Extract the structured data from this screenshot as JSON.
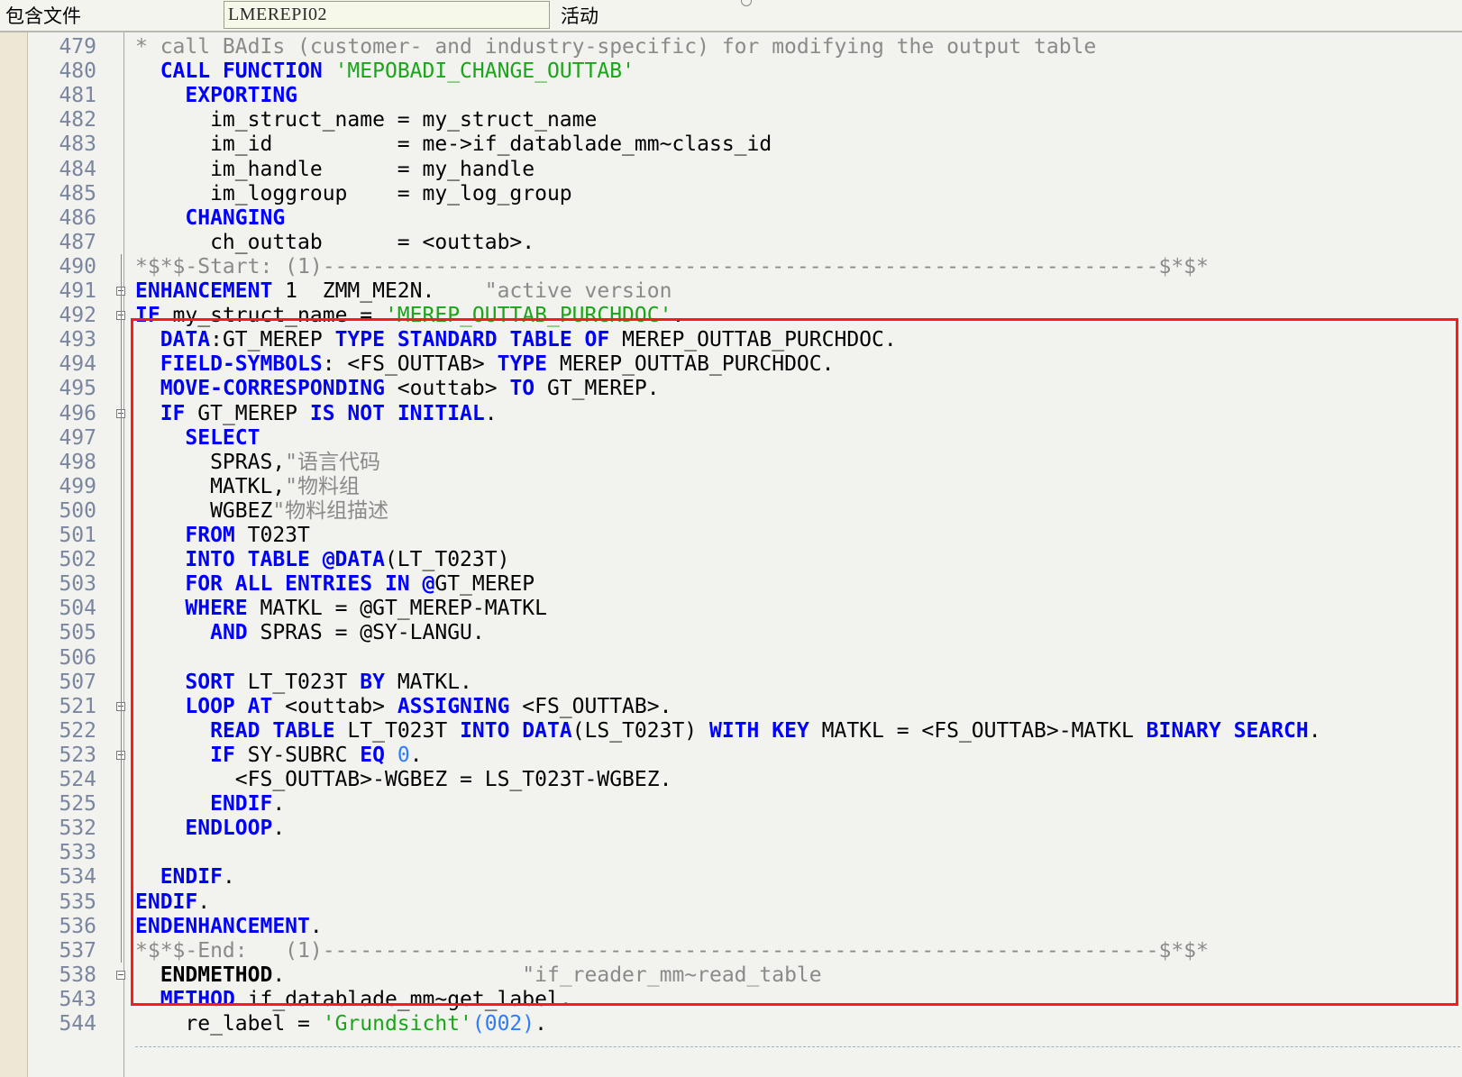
{
  "topbar": {
    "include_label": "包含文件",
    "program_name": "LMEREPI02",
    "status": "活动"
  },
  "colors": {
    "keyword": "#0000ff",
    "string": "#1aa51a",
    "comment": "#8a8a8a",
    "number": "#2b7cff",
    "highlight_box": "#ff1a1a",
    "line_number": "#7a86a0"
  },
  "editor": {
    "lines": [
      {
        "num": "479",
        "tokens": [
          [
            "c",
            "* call BAdIs (customer- and industry-specific) for modifying the output table"
          ]
        ]
      },
      {
        "num": "480",
        "tokens": [
          [
            "t",
            "  "
          ],
          [
            "k",
            "CALL FUNCTION"
          ],
          [
            "t",
            " "
          ],
          [
            "s",
            "'MEPOBADI_CHANGE_OUTTAB'"
          ]
        ]
      },
      {
        "num": "481",
        "tokens": [
          [
            "t",
            "    "
          ],
          [
            "k",
            "EXPORTING"
          ]
        ]
      },
      {
        "num": "482",
        "tokens": [
          [
            "t",
            "      im_struct_name = my_struct_name"
          ]
        ]
      },
      {
        "num": "483",
        "tokens": [
          [
            "t",
            "      im_id          = me->if_datablade_mm~class_id"
          ]
        ]
      },
      {
        "num": "484",
        "tokens": [
          [
            "t",
            "      im_handle      = my_handle"
          ]
        ]
      },
      {
        "num": "485",
        "tokens": [
          [
            "t",
            "      im_loggroup    = my_log_group"
          ]
        ]
      },
      {
        "num": "486",
        "tokens": [
          [
            "t",
            "    "
          ],
          [
            "k",
            "CHANGING"
          ]
        ]
      },
      {
        "num": "487",
        "tokens": [
          [
            "t",
            "      ch_outtab      = <outtab>."
          ]
        ]
      },
      {
        "num": "490",
        "tokens": [
          [
            "c",
            "*$*$-Start: (1)-------------------------------------------------------------------$*$*"
          ]
        ]
      },
      {
        "num": "491",
        "tokens": [
          [
            "k",
            "ENHANCEMENT"
          ],
          [
            "t",
            " 1  ZMM_ME2N.    "
          ],
          [
            "c",
            "\"active version"
          ]
        ]
      },
      {
        "num": "492",
        "tokens": [
          [
            "k",
            "IF"
          ],
          [
            "t",
            " my_struct_name = "
          ],
          [
            "s",
            "'MEREP_OUTTAB_PURCHDOC'"
          ],
          [
            "t",
            "."
          ]
        ]
      },
      {
        "num": "493",
        "tokens": [
          [
            "t",
            "  "
          ],
          [
            "k",
            "DATA"
          ],
          [
            "t",
            ":GT_MEREP "
          ],
          [
            "k",
            "TYPE STANDARD TABLE OF"
          ],
          [
            "t",
            " MEREP_OUTTAB_PURCHDOC."
          ]
        ]
      },
      {
        "num": "494",
        "tokens": [
          [
            "t",
            "  "
          ],
          [
            "k",
            "FIELD-SYMBOLS"
          ],
          [
            "t",
            ": <FS_OUTTAB> "
          ],
          [
            "k",
            "TYPE"
          ],
          [
            "t",
            " MEREP_OUTTAB_PURCHDOC."
          ]
        ]
      },
      {
        "num": "495",
        "tokens": [
          [
            "t",
            "  "
          ],
          [
            "k",
            "MOVE-CORRESPONDING"
          ],
          [
            "t",
            " <outtab> "
          ],
          [
            "k",
            "TO"
          ],
          [
            "t",
            " GT_MEREP."
          ]
        ]
      },
      {
        "num": "496",
        "tokens": [
          [
            "t",
            "  "
          ],
          [
            "k",
            "IF"
          ],
          [
            "t",
            " GT_MEREP "
          ],
          [
            "k",
            "IS NOT INITIAL"
          ],
          [
            "t",
            "."
          ]
        ]
      },
      {
        "num": "497",
        "tokens": [
          [
            "t",
            "    "
          ],
          [
            "k",
            "SELECT"
          ]
        ]
      },
      {
        "num": "498",
        "tokens": [
          [
            "t",
            "      SPRAS,"
          ],
          [
            "c",
            "\"语言代码"
          ]
        ]
      },
      {
        "num": "499",
        "tokens": [
          [
            "t",
            "      MATKL,"
          ],
          [
            "c",
            "\"物料组"
          ]
        ]
      },
      {
        "num": "500",
        "tokens": [
          [
            "t",
            "      WGBEZ"
          ],
          [
            "c",
            "\"物料组描述"
          ]
        ]
      },
      {
        "num": "501",
        "tokens": [
          [
            "t",
            "    "
          ],
          [
            "k",
            "FROM"
          ],
          [
            "t",
            " T023T"
          ]
        ]
      },
      {
        "num": "502",
        "tokens": [
          [
            "t",
            "    "
          ],
          [
            "k",
            "INTO TABLE @DATA"
          ],
          [
            "t",
            "(LT_T023T)"
          ]
        ]
      },
      {
        "num": "503",
        "tokens": [
          [
            "t",
            "    "
          ],
          [
            "k",
            "FOR ALL ENTRIES IN @"
          ],
          [
            "t",
            "GT_MEREP"
          ]
        ]
      },
      {
        "num": "504",
        "tokens": [
          [
            "t",
            "    "
          ],
          [
            "k",
            "WHERE"
          ],
          [
            "t",
            " MATKL = @GT_MEREP-MATKL"
          ]
        ]
      },
      {
        "num": "505",
        "tokens": [
          [
            "t",
            "      "
          ],
          [
            "k",
            "AND"
          ],
          [
            "t",
            " SPRAS = @SY-LANGU."
          ]
        ]
      },
      {
        "num": "506",
        "tokens": []
      },
      {
        "num": "507",
        "tokens": [
          [
            "t",
            "    "
          ],
          [
            "k",
            "SORT"
          ],
          [
            "t",
            " LT_T023T "
          ],
          [
            "k",
            "BY"
          ],
          [
            "t",
            " MATKL."
          ]
        ]
      },
      {
        "num": "521",
        "tokens": [
          [
            "t",
            "    "
          ],
          [
            "k",
            "LOOP AT"
          ],
          [
            "t",
            " <outtab> "
          ],
          [
            "k",
            "ASSIGNING"
          ],
          [
            "t",
            " <FS_OUTTAB>."
          ]
        ]
      },
      {
        "num": "522",
        "tokens": [
          [
            "t",
            "      "
          ],
          [
            "k",
            "READ TABLE"
          ],
          [
            "t",
            " LT_T023T "
          ],
          [
            "k",
            "INTO DATA"
          ],
          [
            "t",
            "(LS_T023T) "
          ],
          [
            "k",
            "WITH KEY"
          ],
          [
            "t",
            " MATKL = <FS_OUTTAB>-MATKL "
          ],
          [
            "k",
            "BINARY SEARCH"
          ],
          [
            "t",
            "."
          ]
        ]
      },
      {
        "num": "523",
        "tokens": [
          [
            "t",
            "      "
          ],
          [
            "k",
            "IF"
          ],
          [
            "t",
            " SY-SUBRC "
          ],
          [
            "k",
            "EQ"
          ],
          [
            "t",
            " "
          ],
          [
            "n",
            "0"
          ],
          [
            "t",
            "."
          ]
        ]
      },
      {
        "num": "524",
        "tokens": [
          [
            "t",
            "        <FS_OUTTAB>-WGBEZ = LS_T023T-WGBEZ."
          ]
        ]
      },
      {
        "num": "525",
        "tokens": [
          [
            "t",
            "      "
          ],
          [
            "k",
            "ENDIF"
          ],
          [
            "t",
            "."
          ]
        ]
      },
      {
        "num": "532",
        "tokens": [
          [
            "t",
            "    "
          ],
          [
            "k",
            "ENDLOOP"
          ],
          [
            "t",
            "."
          ]
        ]
      },
      {
        "num": "533",
        "tokens": []
      },
      {
        "num": "534",
        "tokens": [
          [
            "t",
            "  "
          ],
          [
            "k",
            "ENDIF"
          ],
          [
            "t",
            "."
          ]
        ]
      },
      {
        "num": "535",
        "tokens": [
          [
            "k",
            "ENDIF"
          ],
          [
            "t",
            "."
          ]
        ]
      },
      {
        "num": "536",
        "tokens": [
          [
            "k",
            "ENDENHANCEMENT"
          ],
          [
            "t",
            "."
          ]
        ]
      },
      {
        "num": "537",
        "tokens": [
          [
            "c",
            "*$*$-End:   (1)-------------------------------------------------------------------$*$*"
          ]
        ]
      },
      {
        "num": "538",
        "tokens": [
          [
            "t",
            "  "
          ],
          [
            "b",
            "ENDMETHOD"
          ],
          [
            "t",
            ".                   "
          ],
          [
            "c",
            "\"if_reader_mm~read_table"
          ]
        ]
      },
      {
        "num": "543",
        "tokens": [
          [
            "t",
            "  "
          ],
          [
            "k",
            "METHOD"
          ],
          [
            "t",
            " if_datablade_mm~get_label."
          ]
        ]
      },
      {
        "num": "544",
        "tokens": [
          [
            "t",
            "    re_label = "
          ],
          [
            "s",
            "'Grundsicht'"
          ],
          [
            "n",
            "(002)"
          ],
          [
            "t",
            "."
          ]
        ]
      }
    ]
  }
}
